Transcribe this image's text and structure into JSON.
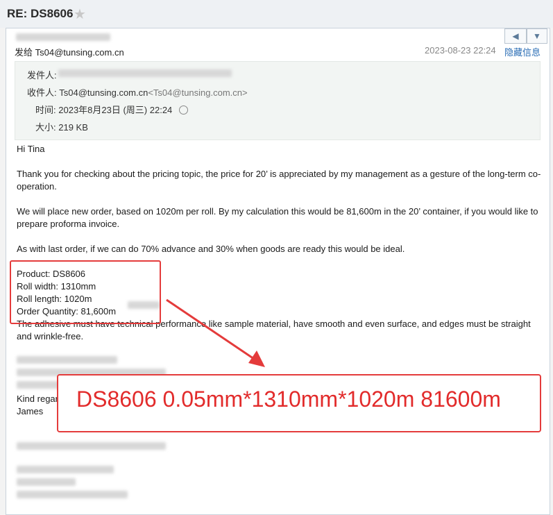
{
  "subject": "RE: DS8606",
  "to_line": "发给 Ts04@tunsing.com.cn",
  "date": "2023-08-23 22:24",
  "hide_info": "隐藏信息",
  "meta": {
    "from_label": "发件人:",
    "to_label": "收件人:",
    "to_name": "Ts04@tunsing.com.cn",
    "to_addr": "<Ts04@tunsing.com.cn>",
    "time_label": "时间:",
    "time_value": "2023年8月23日 (周三) 22:24",
    "size_label": "大小:",
    "size_value": "219 KB"
  },
  "body": {
    "greeting": "Hi Tina",
    "p1": "Thank you for checking about the pricing topic, the price for 20’ is appreciated by my management as a gesture of the long-term co-operation.",
    "p2": "We will place new order, based on 1020m per roll. By my calculation this would be 81,600m in the 20’ container, if you would like to prepare proforma invoice.",
    "p3": "As with last order, if we can do 70% advance and 30% when goods are ready this would be ideal.",
    "product": "Product: DS8606",
    "roll_width": "Roll width: 1310mm",
    "roll_length": "Roll length: 1020m",
    "order_qty": "Order Quantity: 81,600m",
    "p4": "The adhesive must have technical performance like sample material, have smooth and even surface, and edges must be straight and wrinkle-free.",
    "kind_regards": "Kind regards",
    "signature": "James"
  },
  "annotation": "DS8606 0.05mm*1310mm*1020m 81600m",
  "colors": {
    "accent": "#e43b3b",
    "link": "#2a6db5"
  },
  "icons": {
    "star": "star-icon",
    "reply": "reply-arrow-icon",
    "dropdown": "chevron-down-icon",
    "clock": "clock-icon"
  }
}
